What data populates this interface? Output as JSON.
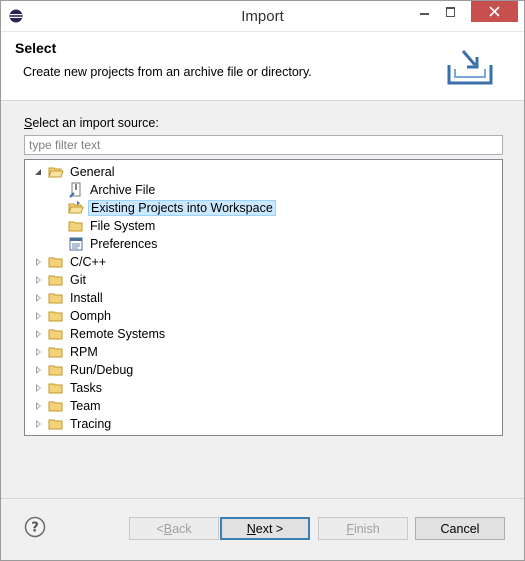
{
  "window": {
    "title": "Import"
  },
  "banner": {
    "title": "Select",
    "description": "Create new projects from an archive file or directory."
  },
  "source": {
    "label_mnemonic": "S",
    "label_rest": "elect an import source:",
    "filter_placeholder": "type filter text"
  },
  "tree": {
    "items": [
      {
        "label": "General",
        "expanded": true,
        "level": 0,
        "icon": "folder-open-icon"
      },
      {
        "label": "Archive File",
        "level": 1,
        "icon": "archive-file-icon"
      },
      {
        "label": "Existing Projects into Workspace",
        "level": 1,
        "icon": "existing-projects-icon",
        "selected": true
      },
      {
        "label": "File System",
        "level": 1,
        "icon": "folder-icon"
      },
      {
        "label": "Preferences",
        "level": 1,
        "icon": "preferences-icon"
      },
      {
        "label": "C/C++",
        "level": 0,
        "icon": "folder-icon"
      },
      {
        "label": "Git",
        "level": 0,
        "icon": "folder-icon"
      },
      {
        "label": "Install",
        "level": 0,
        "icon": "folder-icon"
      },
      {
        "label": "Oomph",
        "level": 0,
        "icon": "folder-icon"
      },
      {
        "label": "Remote Systems",
        "level": 0,
        "icon": "folder-icon"
      },
      {
        "label": "RPM",
        "level": 0,
        "icon": "folder-icon"
      },
      {
        "label": "Run/Debug",
        "level": 0,
        "icon": "folder-icon"
      },
      {
        "label": "Tasks",
        "level": 0,
        "icon": "folder-icon"
      },
      {
        "label": "Team",
        "level": 0,
        "icon": "folder-icon"
      },
      {
        "label": "Tracing",
        "level": 0,
        "icon": "folder-icon"
      }
    ]
  },
  "buttons": {
    "back_arrow": "< ",
    "back_mnemonic": "B",
    "back_rest": "ack",
    "next_mnemonic": "N",
    "next_rest": "ext >",
    "finish_mnemonic": "F",
    "finish_rest": "inish",
    "cancel": "Cancel"
  },
  "colors": {
    "selection_bg": "#cce8ff",
    "selection_border": "#99d1ff",
    "close_button": "#c7504f",
    "folder": "#e8c25a",
    "default_button_border": "#3c7fb1"
  }
}
